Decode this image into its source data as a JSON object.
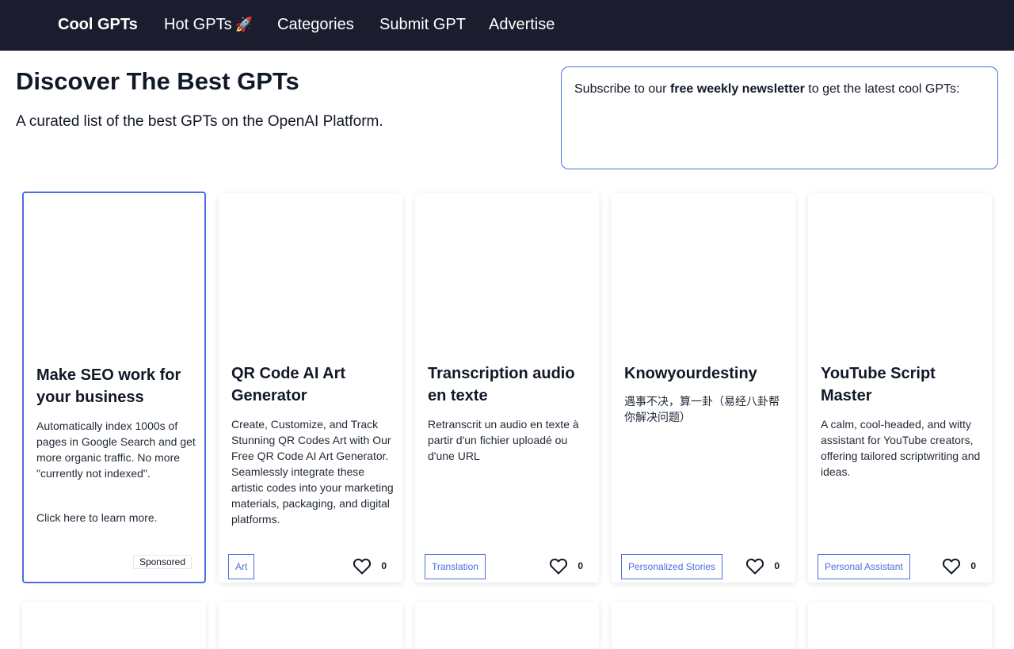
{
  "nav": {
    "brand": "Cool GPTs",
    "links": [
      {
        "label": "Hot GPTs",
        "emoji": "🚀"
      },
      {
        "label": "Categories"
      },
      {
        "label": "Submit GPT"
      },
      {
        "label": "Advertise"
      }
    ]
  },
  "hero": {
    "title": "Discover The Best GPTs",
    "subtitle": "A curated list of the best GPTs on the OpenAI Platform."
  },
  "newsletter": {
    "text_before": "Subscribe to our ",
    "text_bold": "free weekly newsletter",
    "text_after": " to get the latest cool GPTs:"
  },
  "cards": [
    {
      "title": "Make SEO work for your business",
      "description": "Automatically index 1000s of pages in Google Search and get more organic traffic. No more \"currently not indexed\".",
      "cta": "Click here to learn more.",
      "badge": "Sponsored"
    },
    {
      "title": "QR Code AI Art Generator",
      "description": "Create, Customize, and Track Stunning QR Codes Art with Our Free QR Code AI Art Generator. Seamlessly integrate these artistic codes into your marketing materials, packaging, and digital platforms.",
      "tag": "Art",
      "likes": "0"
    },
    {
      "title": "Transcription audio en texte",
      "description": "Retranscrit un audio en texte à partir d'un fichier uploadé ou d'une URL",
      "tag": "Translation",
      "likes": "0"
    },
    {
      "title": "Knowyourdestiny",
      "description": "遇事不决，算一卦（易经八卦帮你解决问题）",
      "tag": "Personalized Stories",
      "likes": "0"
    },
    {
      "title": "YouTube Script Master",
      "description": "A calm, cool-headed, and witty assistant for YouTube creators, offering tailored scriptwriting and ideas.",
      "tag": "Personal Assistant",
      "likes": "0"
    }
  ],
  "colors": {
    "navbar_bg": "#1b1c2e",
    "accent": "#4a6ee0"
  }
}
